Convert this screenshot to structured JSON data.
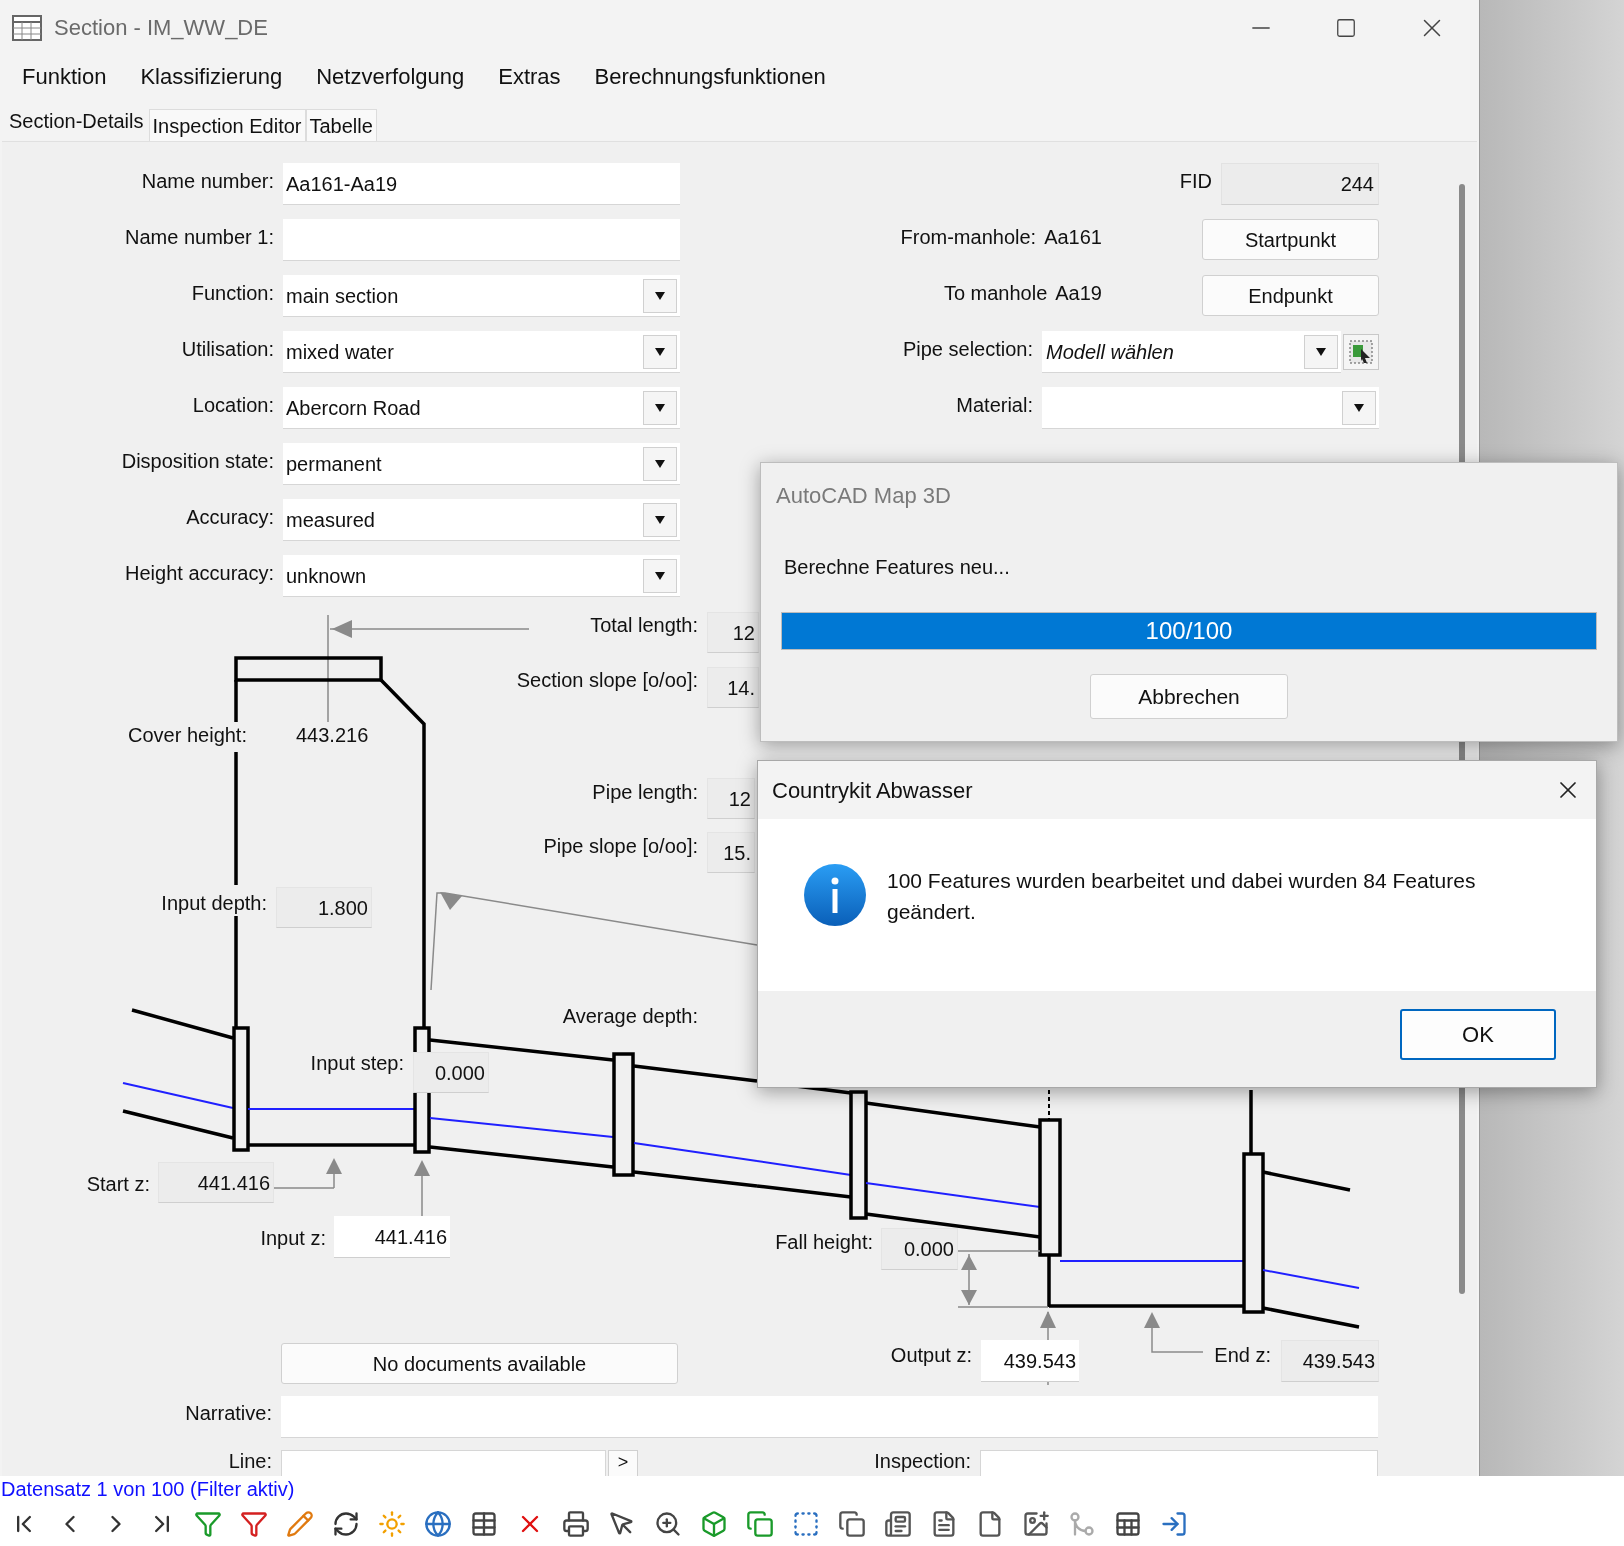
{
  "window": {
    "title": "Section - IM_WW_DE"
  },
  "menu": [
    "Funktion",
    "Klassifizierung",
    "Netzverfolgung",
    "Extras",
    "Berechnungsfunktionen"
  ],
  "tabs": [
    {
      "label": "Section-Details",
      "selected": true
    },
    {
      "label": "Inspection Editor",
      "selected": false
    },
    {
      "label": "Tabelle",
      "selected": false
    }
  ],
  "form_left": [
    {
      "kind": "text",
      "label": "Name number:",
      "value": "Aa161-Aa19"
    },
    {
      "kind": "text",
      "label": "Name number 1:"
    },
    {
      "kind": "dropdown",
      "label": "Function:",
      "value": "main section"
    },
    {
      "kind": "dropdown",
      "label": "Utilisation:",
      "value": "mixed water"
    },
    {
      "kind": "dropdown",
      "label": "Location:",
      "value": "Abercorn Road"
    },
    {
      "kind": "dropdown",
      "label": "Disposition state:",
      "value": "permanent"
    },
    {
      "kind": "dropdown",
      "label": "Accuracy:",
      "value": "measured"
    },
    {
      "kind": "dropdown",
      "label": "Height accuracy:",
      "value": "unknown"
    }
  ],
  "form_right": [
    {
      "kind": "readonly",
      "label": "FID",
      "value": "244"
    },
    {
      "kind": "manhole",
      "label": "From-manhole:",
      "value": "Aa161",
      "button": "Startpunkt"
    },
    {
      "kind": "manhole",
      "label": "To manhole",
      "value": "Aa19",
      "button": "Endpunkt"
    },
    {
      "kind": "picker",
      "label": "Pipe selection:",
      "value": "Modell wählen"
    },
    {
      "kind": "dropdown",
      "label": "Material:"
    }
  ],
  "profile_fields": [
    {
      "kind": "readonly",
      "label": "Total length:",
      "value": "12"
    },
    {
      "kind": "readonly",
      "label": "Section slope [o/oo]:",
      "value": "14."
    },
    {
      "kind": "plain",
      "label": "Cover height:",
      "value": "443.216"
    },
    {
      "kind": "readonly",
      "label": "Pipe length:",
      "value": "12"
    },
    {
      "kind": "readonly",
      "label": "Pipe slope [o/oo]:",
      "value": "15."
    },
    {
      "kind": "readonly",
      "label": "Input depth:",
      "value": "1.800"
    },
    {
      "label": "Average depth:"
    },
    {
      "kind": "readonly",
      "label": "Input step:",
      "value": "0.000"
    },
    {
      "kind": "readonly",
      "label": "Start z:",
      "value": "441.416"
    },
    {
      "kind": "input",
      "label": "Input z:",
      "value": "441.416"
    },
    {
      "kind": "readonly",
      "label": "Fall height:",
      "value": "0.000"
    },
    {
      "kind": "input",
      "label": "Output z:",
      "value": "439.543"
    },
    {
      "kind": "readonly",
      "label": "End z:",
      "value": "439.543"
    }
  ],
  "documents_button": "No documents available",
  "narrative": {
    "label": "Narrative:"
  },
  "line": {
    "label": "Line:",
    "button": ">"
  },
  "inspection": {
    "label": "Inspection:"
  },
  "status": "Datensatz 1 von 100 (Filter aktiv)",
  "progress_dialog": {
    "title": "AutoCAD Map 3D",
    "message": "Berechne Features neu...",
    "level": 1,
    "reading": "100/100",
    "button": "Abbrechen"
  },
  "message_dialog": {
    "title": "Countrykit Abwasser",
    "message": "100 Features wurden bearbeitet und dabei wurden 84 Features geändert.",
    "button": "OK"
  }
}
